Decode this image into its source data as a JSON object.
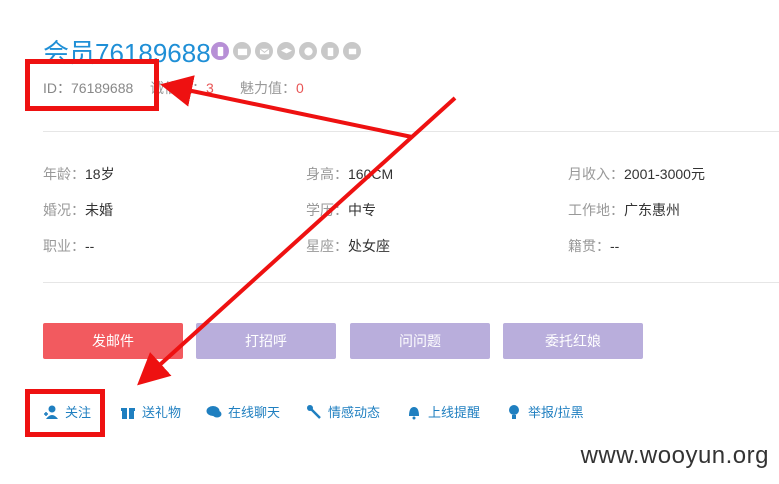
{
  "profile": {
    "title": "会员76189688",
    "id_label": "ID：76189688",
    "credit_label": "诚信值：",
    "credit_value": "3",
    "charm_label": "魅力值：",
    "charm_value": "0"
  },
  "badges": [
    "phone-icon",
    "id-card-icon",
    "mail-icon",
    "education-icon",
    "income-icon",
    "house-icon",
    "car-icon"
  ],
  "details": {
    "age": {
      "label": "年龄：",
      "value": "18岁"
    },
    "height": {
      "label": "身高：",
      "value": "160CM"
    },
    "income": {
      "label": "月收入：",
      "value": "2001-3000元"
    },
    "marriage": {
      "label": "婚况：",
      "value": "未婚"
    },
    "education": {
      "label": "学历：",
      "value": "中专"
    },
    "workplace": {
      "label": "工作地：",
      "value": "广东惠州"
    },
    "job": {
      "label": "职业：",
      "value": "--"
    },
    "constellation": {
      "label": "星座：",
      "value": "处女座"
    },
    "hometown": {
      "label": "籍贯：",
      "value": "--"
    }
  },
  "buttons": {
    "send_mail": "发邮件",
    "greet": "打招呼",
    "question": "问问题",
    "matchmaker": "委托红娘"
  },
  "actions": {
    "follow": "关注",
    "gift": "送礼物",
    "chat": "在线聊天",
    "feed": "情感动态",
    "remind": "上线提醒",
    "report": "举报/拉黑"
  },
  "colors": {
    "title": "#1f8fd6",
    "primary_button": "#f25a5f",
    "secondary_button": "#b9aedc",
    "highlight": "#ee1111"
  },
  "watermark": "www.wooyun.org"
}
